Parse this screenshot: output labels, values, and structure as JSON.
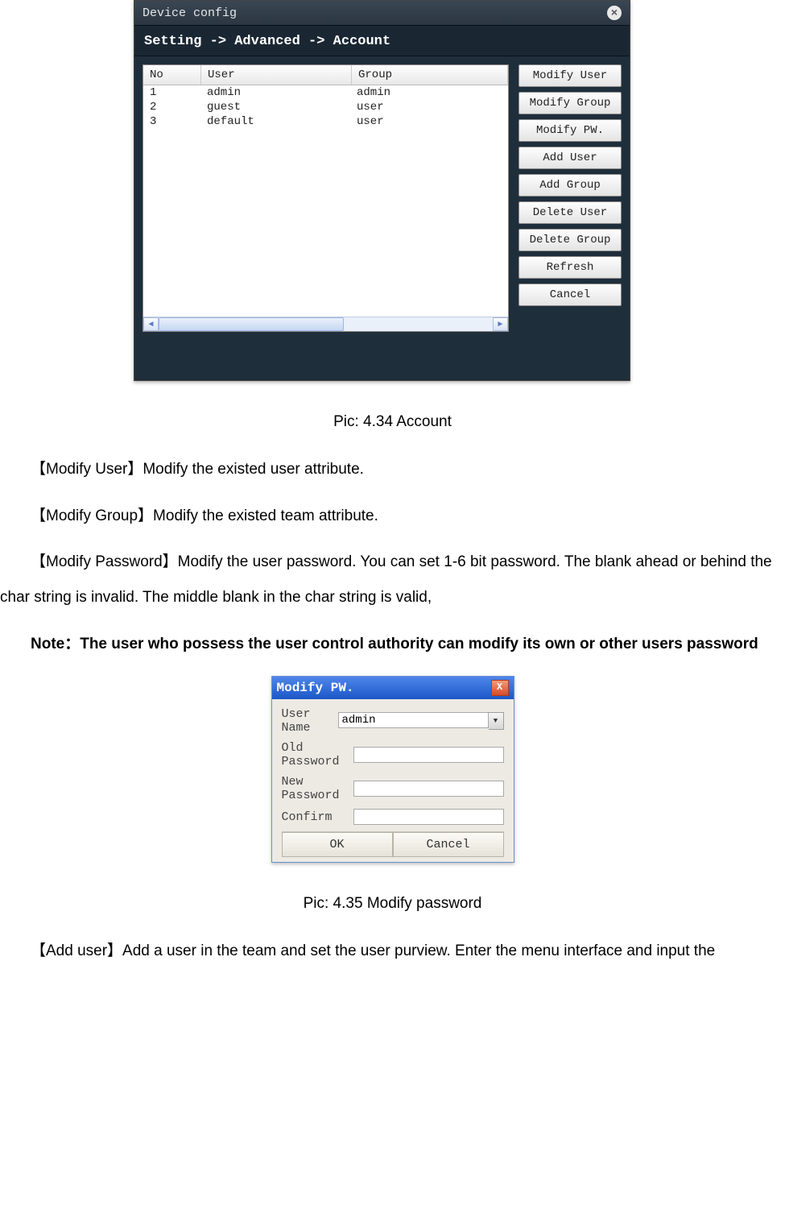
{
  "deviceConfig": {
    "title": "Device config",
    "breadcrumb": "Setting -> Advanced -> Account",
    "columns": {
      "no": "No",
      "user": "User",
      "group": "Group"
    },
    "rows": [
      {
        "no": "1",
        "user": "admin",
        "group": "admin"
      },
      {
        "no": "2",
        "user": "guest",
        "group": "user"
      },
      {
        "no": "3",
        "user": "default",
        "group": "user"
      }
    ],
    "buttons": {
      "modifyUser": "Modify User",
      "modifyGroup": "Modify Group",
      "modifyPW": "Modify PW.",
      "addUser": "Add User",
      "addGroup": "Add Group",
      "deleteUser": "Delete User",
      "deleteGroup": "Delete Group",
      "refresh": "Refresh",
      "cancel": "Cancel"
    }
  },
  "caption1": "Pic: 4.34 Account",
  "doc": {
    "modifyUser": "【Modify User】Modify the existed user attribute.",
    "modifyGroup": "【Modify Group】Modify the existed team attribute.",
    "modifyPassword": "【Modify Password】Modify the user password. You can set 1-6 bit password. The blank ahead or behind the char string is invalid. The middle blank in the char string is valid,",
    "note": "Note：The user who possess the user control authority can modify its own or other users password",
    "addUser": "【Add user】Add a user in the team and set the user purview. Enter the menu interface and input the"
  },
  "pw": {
    "title": "Modify PW.",
    "labels": {
      "userName": "User Name",
      "oldPassword": "Old Password",
      "newPassword": "New Password",
      "confirm": "Confirm"
    },
    "userNameValue": "admin",
    "ok": "OK",
    "cancel": "Cancel"
  },
  "caption2": "Pic: 4.35 Modify password"
}
